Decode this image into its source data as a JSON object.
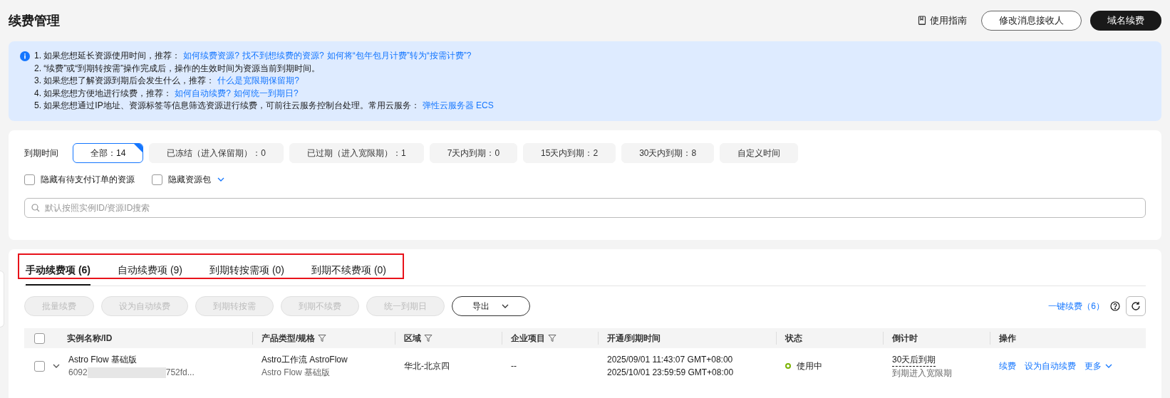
{
  "header": {
    "title": "续费管理",
    "guide_link": "使用指南",
    "buttons": [
      {
        "label": "修改消息接收人",
        "kind": "outline"
      },
      {
        "label": "域名续费",
        "kind": "primary"
      }
    ]
  },
  "notice": {
    "lines": [
      {
        "text": "1. 如果您想延长资源使用时间，推荐：",
        "links": [
          "如何续费资源?",
          "找不到想续费的资源?",
          "如何将“包年包月计费”转为“按需计费”?"
        ]
      },
      {
        "text": "2. “续费”或“到期转按需”操作完成后，操作的生效时间为资源当前到期时间。"
      },
      {
        "text": "3. 如果您想了解资源到期后会发生什么，推荐：",
        "links": [
          "什么是宽限期保留期?"
        ]
      },
      {
        "text": "4. 如果您想方便地进行续费，推荐：",
        "links": [
          "如何自动续费?",
          "如何统一到期日?"
        ]
      },
      {
        "text": "5. 如果您想通过IP地址、资源标签等信息筛选资源进行续费，可前往云服务控制台处理。常用云服务：",
        "links": [
          "弹性云服务器 ECS"
        ]
      }
    ]
  },
  "filters": {
    "label": "到期时间",
    "options": [
      {
        "label": "全部：14",
        "selected": true
      },
      {
        "label": "已冻结（进入保留期）：0",
        "selected": false
      },
      {
        "label": "已过期（进入宽限期）：1",
        "selected": false
      },
      {
        "label": "7天内到期：0",
        "selected": false
      },
      {
        "label": "15天内到期：2",
        "selected": false
      },
      {
        "label": "30天内到期：8",
        "selected": false
      },
      {
        "label": "自定义时间",
        "selected": false
      }
    ],
    "checkboxes": [
      {
        "label": "隐藏有待支付订单的资源",
        "checked": false,
        "dropdown": false
      },
      {
        "label": "隐藏资源包",
        "checked": false,
        "dropdown": true
      }
    ],
    "search": {
      "placeholder": "默认按照实例ID/资源ID搜索"
    }
  },
  "tabs": {
    "highlighted": true,
    "items": [
      {
        "label": "手动续费项 (6)",
        "selected": true
      },
      {
        "label": "自动续费项 (9)",
        "selected": false
      },
      {
        "label": "到期转按需项 (0)",
        "selected": false
      },
      {
        "label": "到期不续费项 (0)",
        "selected": false
      }
    ]
  },
  "toolbar": {
    "buttons": [
      {
        "label": "批量续费",
        "disabled": true
      },
      {
        "label": "设为自动续费",
        "disabled": true
      },
      {
        "label": "到期转按需",
        "disabled": true
      },
      {
        "label": "到期不续费",
        "disabled": true
      },
      {
        "label": "统一到期日",
        "disabled": true
      }
    ],
    "export": "导出",
    "one_click": "一键续费",
    "one_click_count": "（6）"
  },
  "table": {
    "header_checked": false,
    "columns": [
      {
        "label": "实例名称/ID",
        "filter": false
      },
      {
        "label": "产品类型/规格",
        "filter": true
      },
      {
        "label": "区域",
        "filter": true
      },
      {
        "label": "企业项目",
        "filter": true
      },
      {
        "label": "开通/到期时间",
        "filter": false
      },
      {
        "label": "状态",
        "filter": false
      },
      {
        "label": "倒计时",
        "filter": false
      },
      {
        "label": "操作",
        "filter": false
      }
    ],
    "rows": [
      {
        "checked": false,
        "expanded": false,
        "name": "Astro Flow 基础版",
        "id_prefix": "6092",
        "id_suffix": "752fd...",
        "product": "Astro工作流 AstroFlow",
        "spec": "Astro Flow 基础版",
        "region": "华北-北京四",
        "project": "--",
        "start": "2025/09/01 11:43:07 GMT+08:00",
        "end": "2025/10/01 23:59:59 GMT+08:00",
        "status": "使用中",
        "color": "#7cb305",
        "countdown": "30天后到期",
        "countdown_note": "到期进入宽限期",
        "actions": [
          "续费",
          "设为自动续费",
          "更多"
        ]
      }
    ]
  }
}
